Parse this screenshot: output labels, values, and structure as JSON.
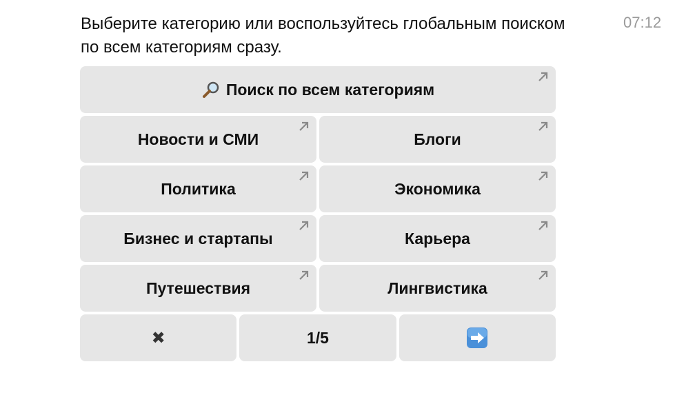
{
  "message": {
    "text": "Выберите категорию или воспользуйтесь глобальным поиском по всем категориям сразу.",
    "time": "07:12"
  },
  "keyboard": {
    "search_button": {
      "label": "Поиск по всем категориям",
      "icon": "magnifier-icon"
    },
    "rows": [
      [
        "Новости и СМИ",
        "Блоги"
      ],
      [
        "Политика",
        "Экономика"
      ],
      [
        "Бизнес и стартапы",
        "Карьера"
      ],
      [
        "Путешествия",
        "Лингвистика"
      ]
    ],
    "nav": {
      "close_symbol": "✖",
      "page": "1/5",
      "next_icon": "right-arrow-emoji-icon"
    },
    "corner_icon": "open-arrow-icon"
  },
  "colors": {
    "button_bg": "#e6e6e6",
    "text": "#111111",
    "time": "#9a9a9a",
    "corner_arrow": "#8a8a8a",
    "next_button_blue": "#4a90d9"
  }
}
